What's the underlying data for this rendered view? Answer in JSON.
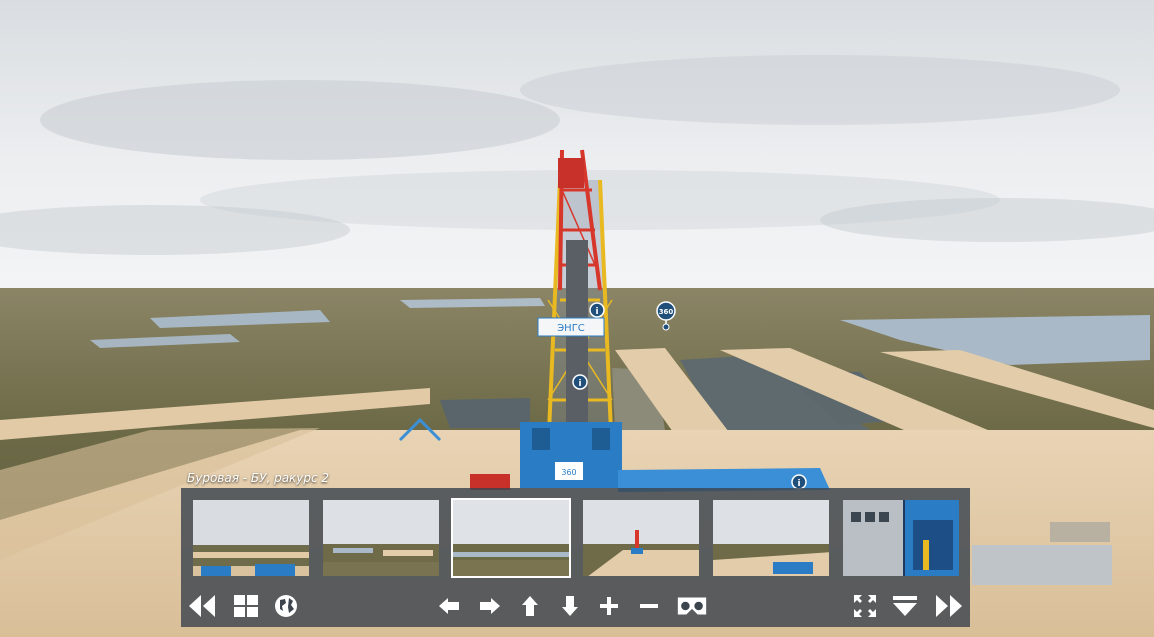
{
  "scene": {
    "caption": "Буровая - БУ, ракурс 2",
    "rig_sign": "ЭНГС",
    "hotspot_360": "360",
    "container_sign": "360"
  },
  "thumbnails": [
    {
      "label": "thumb-1",
      "active": false
    },
    {
      "label": "thumb-2",
      "active": false
    },
    {
      "label": "thumb-3",
      "active": true
    },
    {
      "label": "thumb-4",
      "active": false
    },
    {
      "label": "thumb-5",
      "active": false
    },
    {
      "label": "thumb-6",
      "active": false
    }
  ],
  "toolbar": {
    "left": [
      "prev-scene-icon",
      "thumbnails-grid-icon",
      "map-globe-icon"
    ],
    "center": [
      "pan-left-icon",
      "pan-right-icon",
      "pan-up-icon",
      "pan-down-icon",
      "zoom-in-icon",
      "zoom-out-icon",
      "vr-headset-icon"
    ],
    "right": [
      "fullscreen-icon",
      "hide-panel-icon",
      "next-scene-icon"
    ]
  },
  "colors": {
    "sky": "#e6e9ec",
    "ground": "#6f6a48",
    "sand": "#e5cfae",
    "water": "#a9b9c7",
    "rig_red": "#d7362a",
    "rig_yellow": "#e9b921",
    "rig_blue": "#2a7dc4",
    "panel": "#3c444e",
    "hotspot": "#1f4f7a"
  }
}
